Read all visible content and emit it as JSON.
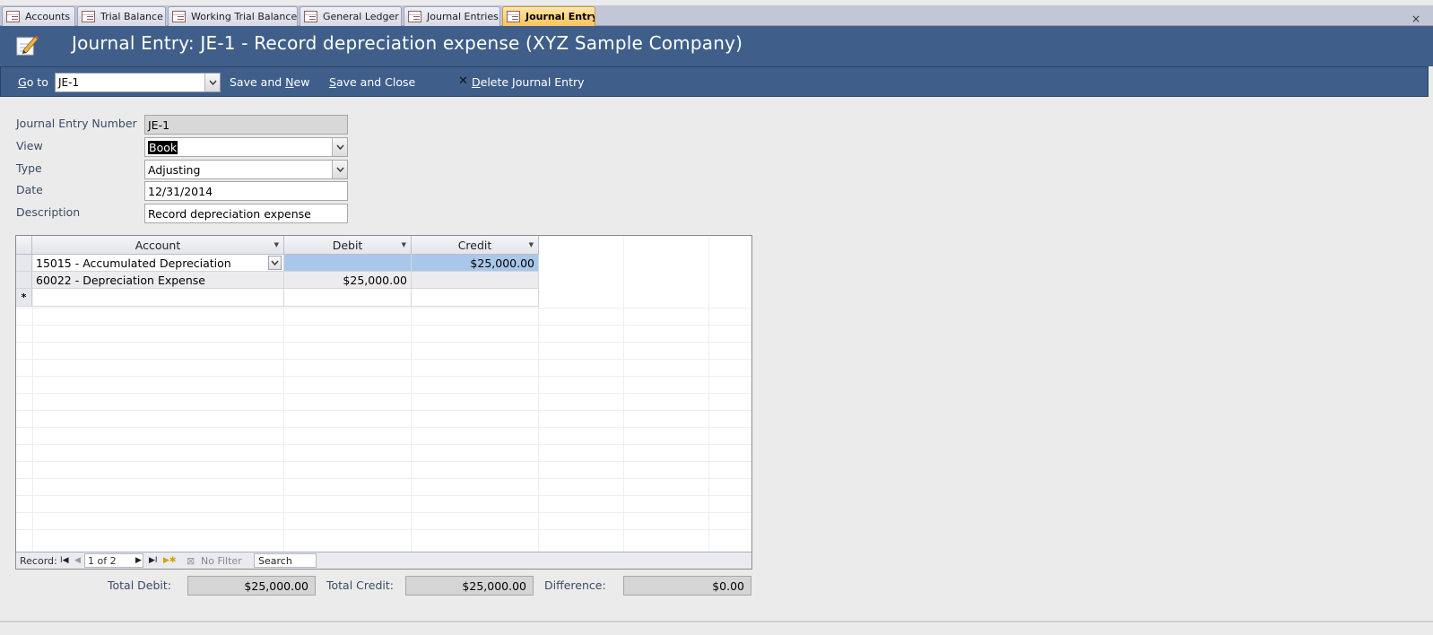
{
  "tabs": [
    {
      "label": "Accounts",
      "active": false
    },
    {
      "label": "Trial Balance",
      "active": false
    },
    {
      "label": "Working Trial Balance",
      "active": false
    },
    {
      "label": "General Ledger",
      "active": false
    },
    {
      "label": "Journal Entries",
      "active": false
    },
    {
      "label": "Journal Entry",
      "active": true
    }
  ],
  "tab_close_glyph": "×",
  "header": {
    "title": "Journal Entry: JE-1  -   Record depreciation expense (XYZ Sample Company)",
    "icon": "pencil-notepad-icon",
    "background_color": "#3f5f8a"
  },
  "toolbar": {
    "goto_label": "Go to",
    "goto_value": "JE-1",
    "save_and_new": "Save and New",
    "save_and_close": "Save and Close",
    "delete": "Delete Journal Entry"
  },
  "form": {
    "journal_entry_number": {
      "label": "Journal Entry Number",
      "value": "JE-1"
    },
    "view": {
      "label": "View",
      "value": "Book"
    },
    "type": {
      "label": "Type",
      "value": "Adjusting"
    },
    "date": {
      "label": "Date",
      "value": "12/31/2014"
    },
    "description": {
      "label": "Description",
      "value": "Record depreciation expense"
    }
  },
  "grid": {
    "columns": [
      "Account",
      "Debit",
      "Credit"
    ],
    "rows": [
      {
        "account": "15015 - Accumulated Depreciation",
        "debit": "",
        "credit": "$25,000.00"
      },
      {
        "account": "60022 - Depreciation Expense",
        "debit": "$25,000.00",
        "credit": ""
      }
    ],
    "new_row_marker": "*"
  },
  "navigation": {
    "record_label": "Record:",
    "record_position": "1 of 2",
    "filter_label": "No Filter",
    "search_label": "Search"
  },
  "totals": {
    "total_debit": {
      "label": "Total Debit:",
      "value": "$25,000.00"
    },
    "total_credit": {
      "label": "Total Credit:",
      "value": "$25,000.00"
    },
    "difference": {
      "label": "Difference:",
      "value": "$0.00"
    }
  }
}
